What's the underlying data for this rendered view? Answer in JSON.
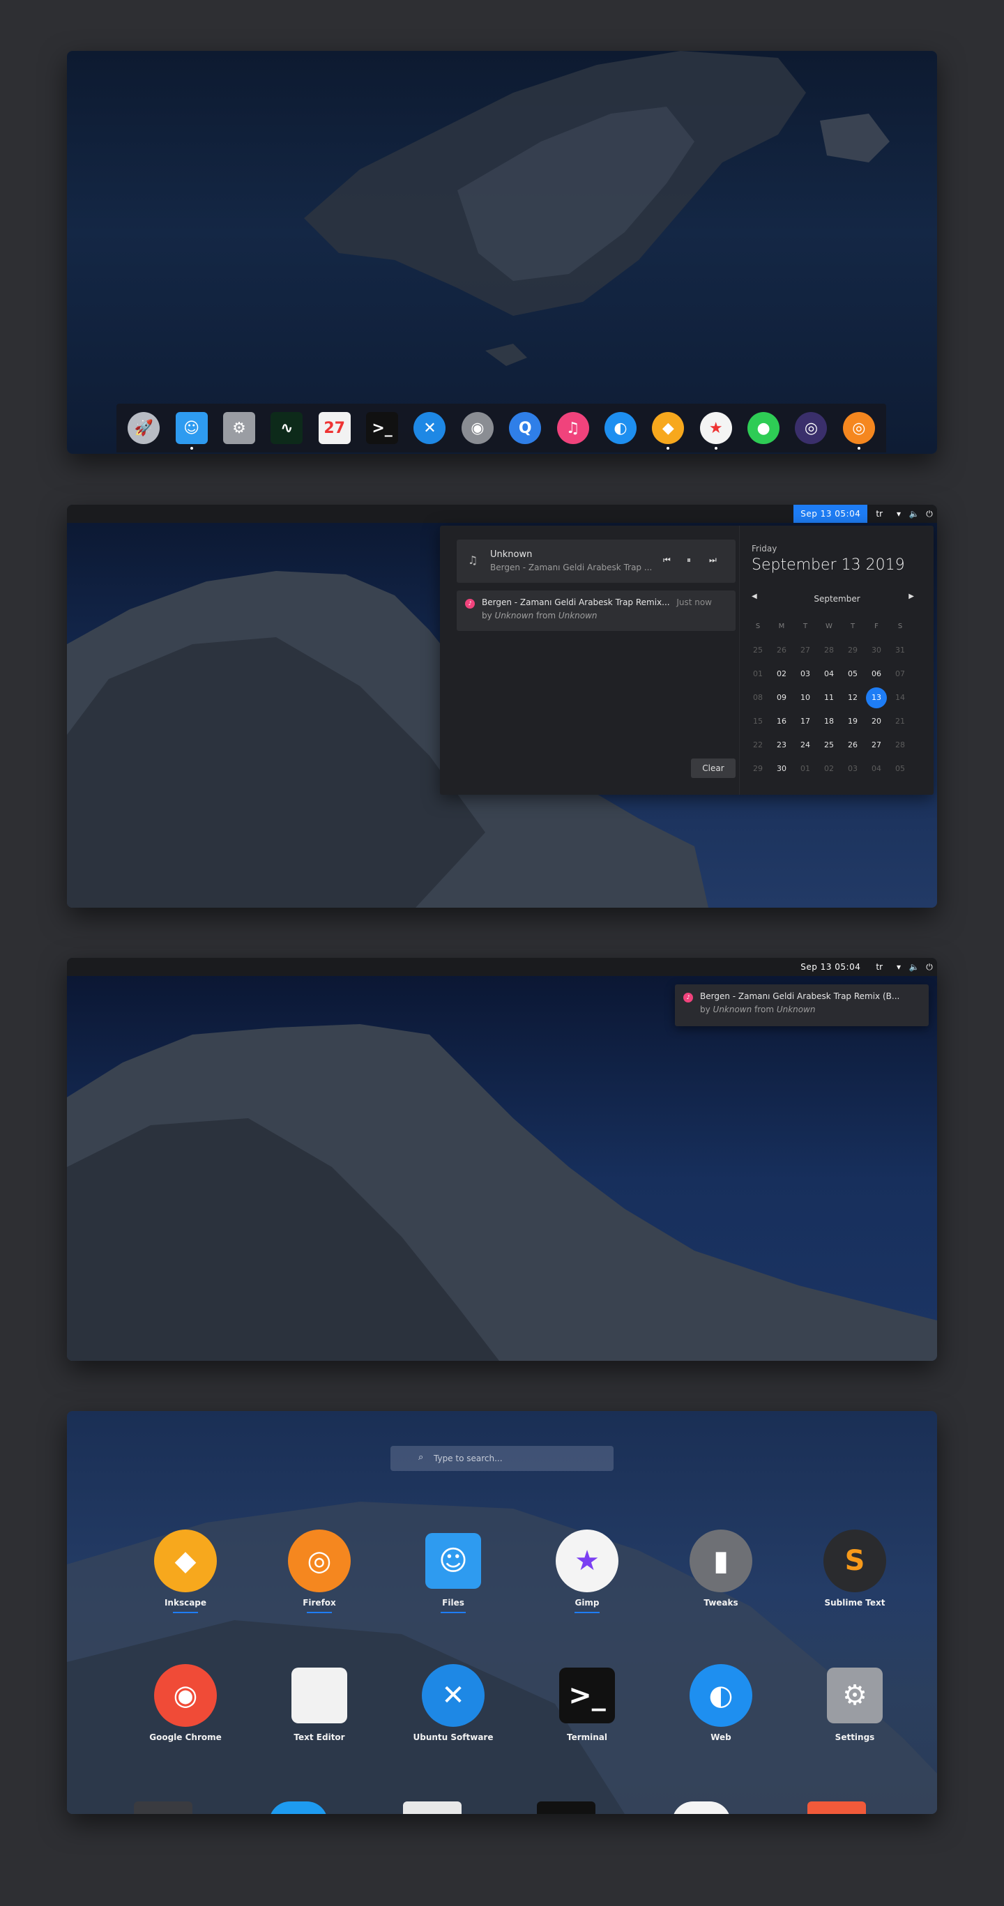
{
  "dock": {
    "items": [
      {
        "name": "launchpad-icon",
        "glyph": "🚀",
        "bg": "#b8bcc4",
        "running": false
      },
      {
        "name": "finder-icon",
        "glyph": "☺",
        "bg": "#2e9bf0",
        "running": true,
        "square": true
      },
      {
        "name": "settings-icon",
        "glyph": "⚙",
        "bg": "#9a9da3",
        "running": false,
        "square": true
      },
      {
        "name": "system-monitor-icon",
        "glyph": "∿",
        "bg": "#0d2a1a",
        "running": false,
        "square": true
      },
      {
        "name": "calendar-icon",
        "glyph": "27",
        "bg": "#f2f2f2",
        "running": false,
        "square": true
      },
      {
        "name": "terminal-icon",
        "glyph": ">_",
        "bg": "#111111",
        "running": false,
        "square": true
      },
      {
        "name": "ubuntu-software-icon",
        "glyph": "✕",
        "bg": "#1e88e5",
        "running": false
      },
      {
        "name": "disks-icon",
        "glyph": "◉",
        "bg": "#8a8d93",
        "running": false
      },
      {
        "name": "quicktime-icon",
        "glyph": "Q",
        "bg": "#2f7fe8",
        "running": false
      },
      {
        "name": "music-icon",
        "glyph": "♫",
        "bg": "#f0437c",
        "running": false
      },
      {
        "name": "safari-icon",
        "glyph": "◐",
        "bg": "#1e8ff0",
        "running": false
      },
      {
        "name": "sketch-icon",
        "glyph": "◆",
        "bg": "#f7a81d",
        "running": true
      },
      {
        "name": "gimp-icon",
        "glyph": "★",
        "bg": "#f4f4f4",
        "running": true
      },
      {
        "name": "messages-icon",
        "glyph": "●",
        "bg": "#2ecc55",
        "running": false
      },
      {
        "name": "siri-icon",
        "glyph": "◎",
        "bg": "#3a2f6b",
        "running": false
      },
      {
        "name": "firefox-icon",
        "glyph": "◎",
        "bg": "#f5871f",
        "running": true
      }
    ]
  },
  "topbar": {
    "clock": "Sep 13  05:04",
    "lang": "tr"
  },
  "media": {
    "title": "Unknown",
    "subtitle": "Bergen - Zamanı Geldi Arabesk Trap ...",
    "prev": "⏮",
    "pause": "⏸",
    "next": "⏭"
  },
  "notification": {
    "title": "Bergen - Zamanı Geldi Arabesk Trap Remix...",
    "title_long": "Bergen - Zamanı Geldi Arabesk Trap Remix (B...",
    "time": "Just now",
    "by": "by ",
    "artist": "Unknown",
    "from": " from ",
    "album": "Unknown",
    "icon": "♪"
  },
  "clear_label": "Clear",
  "calendar": {
    "weekday": "Friday",
    "date": "September 13 2019",
    "month": "September",
    "headers": [
      "S",
      "M",
      "T",
      "W",
      "T",
      "F",
      "S"
    ],
    "days": [
      {
        "d": "25",
        "dim": true
      },
      {
        "d": "26",
        "dim": true
      },
      {
        "d": "27",
        "dim": true
      },
      {
        "d": "28",
        "dim": true
      },
      {
        "d": "29",
        "dim": true
      },
      {
        "d": "30",
        "dim": true
      },
      {
        "d": "31",
        "dim": true
      },
      {
        "d": "01",
        "dim": true
      },
      {
        "d": "02"
      },
      {
        "d": "03"
      },
      {
        "d": "04"
      },
      {
        "d": "05"
      },
      {
        "d": "06"
      },
      {
        "d": "07",
        "dim": true
      },
      {
        "d": "08",
        "dim": true
      },
      {
        "d": "09"
      },
      {
        "d": "10"
      },
      {
        "d": "11"
      },
      {
        "d": "12"
      },
      {
        "d": "13",
        "today": true
      },
      {
        "d": "14",
        "dim": true
      },
      {
        "d": "15",
        "dim": true
      },
      {
        "d": "16"
      },
      {
        "d": "17"
      },
      {
        "d": "18"
      },
      {
        "d": "19"
      },
      {
        "d": "20"
      },
      {
        "d": "21",
        "dim": true
      },
      {
        "d": "22",
        "dim": true
      },
      {
        "d": "23"
      },
      {
        "d": "24"
      },
      {
        "d": "25"
      },
      {
        "d": "26"
      },
      {
        "d": "27"
      },
      {
        "d": "28",
        "dim": true
      },
      {
        "d": "29",
        "dim": true
      },
      {
        "d": "30"
      },
      {
        "d": "01",
        "dim": true
      },
      {
        "d": "02",
        "dim": true
      },
      {
        "d": "03",
        "dim": true
      },
      {
        "d": "04",
        "dim": true
      },
      {
        "d": "05",
        "dim": true
      }
    ]
  },
  "search": {
    "placeholder": "Type to search..."
  },
  "apps": [
    {
      "label": "Inkscape",
      "name": "inkscape-app",
      "glyph": "◆",
      "bg": "#f7a81d",
      "running": true
    },
    {
      "label": "Firefox",
      "name": "firefox-app",
      "glyph": "◎",
      "bg": "#f5871f",
      "running": true
    },
    {
      "label": "Files",
      "name": "files-app",
      "glyph": "☺",
      "bg": "#2e9bf0",
      "running": true,
      "square": true
    },
    {
      "label": "Gimp",
      "name": "gimp-app",
      "glyph": "★",
      "bg": "#f4f4f4",
      "fg": "#7b3ff2",
      "running": true
    },
    {
      "label": "Tweaks",
      "name": "tweaks-app",
      "glyph": "▮",
      "bg": "#6e7075",
      "running": false
    },
    {
      "label": "Sublime Text",
      "name": "sublime-text-app",
      "glyph": "S",
      "bg": "#2a2b2e",
      "fg": "#f79a1a",
      "running": false
    },
    {
      "label": "Google Chrome",
      "name": "google-chrome-app",
      "glyph": "◉",
      "bg": "#f04b37",
      "running": false
    },
    {
      "label": "Text Editor",
      "name": "text-editor-app",
      "glyph": "",
      "bg": "#f2f2f2",
      "running": false,
      "square": true
    },
    {
      "label": "Ubuntu Software",
      "name": "ubuntu-software-app",
      "glyph": "✕",
      "bg": "#1e88e5",
      "running": false
    },
    {
      "label": "Terminal",
      "name": "terminal-app",
      "glyph": ">_",
      "bg": "#111111",
      "running": false,
      "square": true
    },
    {
      "label": "Web",
      "name": "web-app",
      "glyph": "◐",
      "bg": "#1e8ff0",
      "running": false
    },
    {
      "label": "Settings",
      "name": "settings-app",
      "glyph": "⚙",
      "bg": "#9a9da3",
      "running": false,
      "square": true
    }
  ]
}
